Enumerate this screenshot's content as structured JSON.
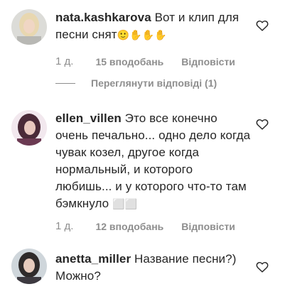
{
  "comments": [
    {
      "username": "nata.kashkarova",
      "text": " Вот и клип для песни снят",
      "emoji": "🙂✋✋✋",
      "time": "1 д.",
      "likes": "15 вподобань",
      "reply": "Відповісти",
      "view_replies": "Переглянути відповіді (1)"
    },
    {
      "username": "ellen_villen",
      "text": " Это все конечно очень печально... одно дело когда чувак козел, другое когда нормальный, и которого любишь... и у которого что-то там бэмкнуло ",
      "emoji": "⬜⬜",
      "time": "1 д.",
      "likes": "12 вподобань",
      "reply": "Відповісти"
    },
    {
      "username": "anetta_miller",
      "text": " Название песни?) Можно?"
    }
  ],
  "colors": {
    "text": "#262626",
    "meta": "#8e8e8e",
    "emoji_yellow": "#f7c41f"
  },
  "icons": [
    "heart-icon"
  ]
}
